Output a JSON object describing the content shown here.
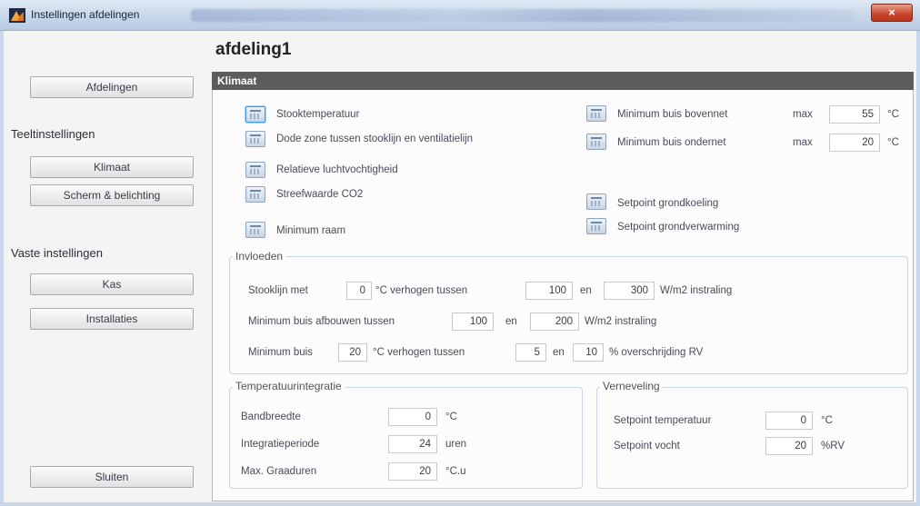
{
  "window": {
    "title": "Instellingen afdelingen",
    "close_glyph": "×",
    "accent_color": "#c8432a"
  },
  "sidebar": {
    "afdelingen_button": "Afdelingen",
    "teelt_heading": "Teeltinstellingen",
    "klimaat_button": "Klimaat",
    "scherm_button": "Scherm & belichting",
    "vaste_heading": "Vaste instellingen",
    "kas_button": "Kas",
    "installaties_button": "Installaties",
    "sluiten_button": "Sluiten"
  },
  "page_title": "afdeling1",
  "klimaat": {
    "header": "Klimaat",
    "items_left": [
      {
        "label": "Stooktemperatuur",
        "icon": "table-icon"
      },
      {
        "label": "Dode zone tussen stooklijn en ventilatielijn",
        "icon": "table-icon"
      },
      {
        "label": "Relatieve luchtvochtigheid",
        "icon": "table-icon"
      },
      {
        "label": "Streefwaarde CO2",
        "icon": "table-icon"
      },
      {
        "label": "Minimum raam",
        "icon": "table-icon"
      }
    ],
    "items_right": [
      {
        "label": "Minimum buis bovennet",
        "max_label": "max",
        "value": "55",
        "unit": "°C"
      },
      {
        "label": "Minimum buis ondernet",
        "max_label": "max",
        "value": "20",
        "unit": "°C"
      },
      {
        "label": "Setpoint grondkoeling"
      },
      {
        "label": "Setpoint grondverwarming"
      }
    ]
  },
  "invloeden": {
    "title": "Invloeden",
    "row1": {
      "prefix": "Stooklijn met",
      "value1": "0",
      "mid": "°C verhogen tussen",
      "value2": "100",
      "en": "en",
      "value3": "300",
      "suffix": "W/m2 instraling"
    },
    "row2": {
      "prefix": "Minimum buis afbouwen tussen",
      "value1": "100",
      "en": "en",
      "value2": "200",
      "suffix": "W/m2 instraling"
    },
    "row3": {
      "prefix": "Minimum buis",
      "value1": "20",
      "mid": "°C verhogen tussen",
      "value2": "5",
      "en": "en",
      "value3": "10",
      "suffix": "% overschrijding RV"
    }
  },
  "temperatuurintegratie": {
    "title": "Temperatuurintegratie",
    "rows": [
      {
        "label": "Bandbreedte",
        "value": "0",
        "unit": "°C"
      },
      {
        "label": "Integratieperiode",
        "value": "24",
        "unit": "uren"
      },
      {
        "label": "Max. Graaduren",
        "value": "20",
        "unit": "°C.u"
      }
    ]
  },
  "verneveling": {
    "title": "Verneveling",
    "rows": [
      {
        "label": "Setpoint temperatuur",
        "value": "0",
        "unit": "°C"
      },
      {
        "label": "Setpoint vocht",
        "value": "20",
        "unit": "%RV"
      }
    ]
  }
}
